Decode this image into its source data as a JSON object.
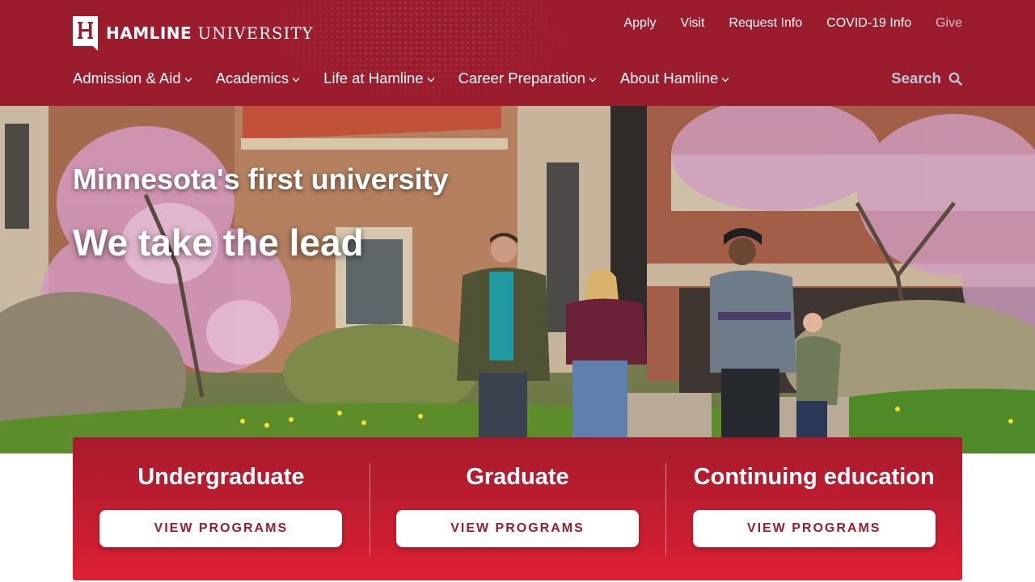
{
  "brand": {
    "name_bold": "HAMLINE",
    "name_rest": "UNIVERSITY",
    "logo_letter": "H",
    "color_primary": "#9b1c2c",
    "color_accent": "#df1f33"
  },
  "utility_nav": {
    "apply": "Apply",
    "visit": "Visit",
    "request_info": "Request Info",
    "covid": "COVID-19 Info",
    "give": "Give"
  },
  "main_nav": {
    "admission": "Admission & Aid",
    "academics": "Academics",
    "life": "Life at Hamline",
    "career": "Career Preparation",
    "about": "About Hamline"
  },
  "search": {
    "label": "Search",
    "icon": "search-icon"
  },
  "hero": {
    "tagline": "Minnesota's first university",
    "headline": "We take the lead"
  },
  "programs": [
    {
      "title": "Undergraduate",
      "button": "VIEW PROGRAMS"
    },
    {
      "title": "Graduate",
      "button": "VIEW PROGRAMS"
    },
    {
      "title": "Continuing education",
      "button": "VIEW PROGRAMS"
    }
  ]
}
